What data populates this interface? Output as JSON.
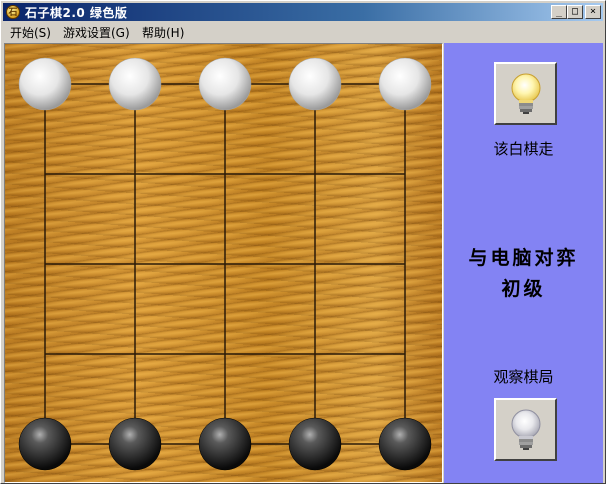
{
  "window": {
    "title": "石子棋2.0  绿色版",
    "app_icon_glyph": "石",
    "minimize_glyph": "_",
    "maximize_glyph": "□",
    "close_glyph": "×"
  },
  "menu": {
    "items": [
      {
        "label": "开始(S)"
      },
      {
        "label": "游戏设置(G)"
      },
      {
        "label": "帮助(H)"
      }
    ]
  },
  "board": {
    "grid_size": 5,
    "pieces": [
      {
        "color": "white",
        "row": 0,
        "col": 0
      },
      {
        "color": "white",
        "row": 0,
        "col": 1
      },
      {
        "color": "white",
        "row": 0,
        "col": 2
      },
      {
        "color": "white",
        "row": 0,
        "col": 3
      },
      {
        "color": "white",
        "row": 0,
        "col": 4
      },
      {
        "color": "black",
        "row": 4,
        "col": 0
      },
      {
        "color": "black",
        "row": 4,
        "col": 1
      },
      {
        "color": "black",
        "row": 4,
        "col": 2
      },
      {
        "color": "black",
        "row": 4,
        "col": 3
      },
      {
        "color": "black",
        "row": 4,
        "col": 4
      }
    ]
  },
  "panel": {
    "turn_status": "该白棋走",
    "mode_line1": "与电脑对弈",
    "mode_line2": "初级",
    "observe_label": "观察棋局",
    "top_bulb": "lit",
    "bottom_bulb": "unlit",
    "background_color": "#8383f3"
  }
}
